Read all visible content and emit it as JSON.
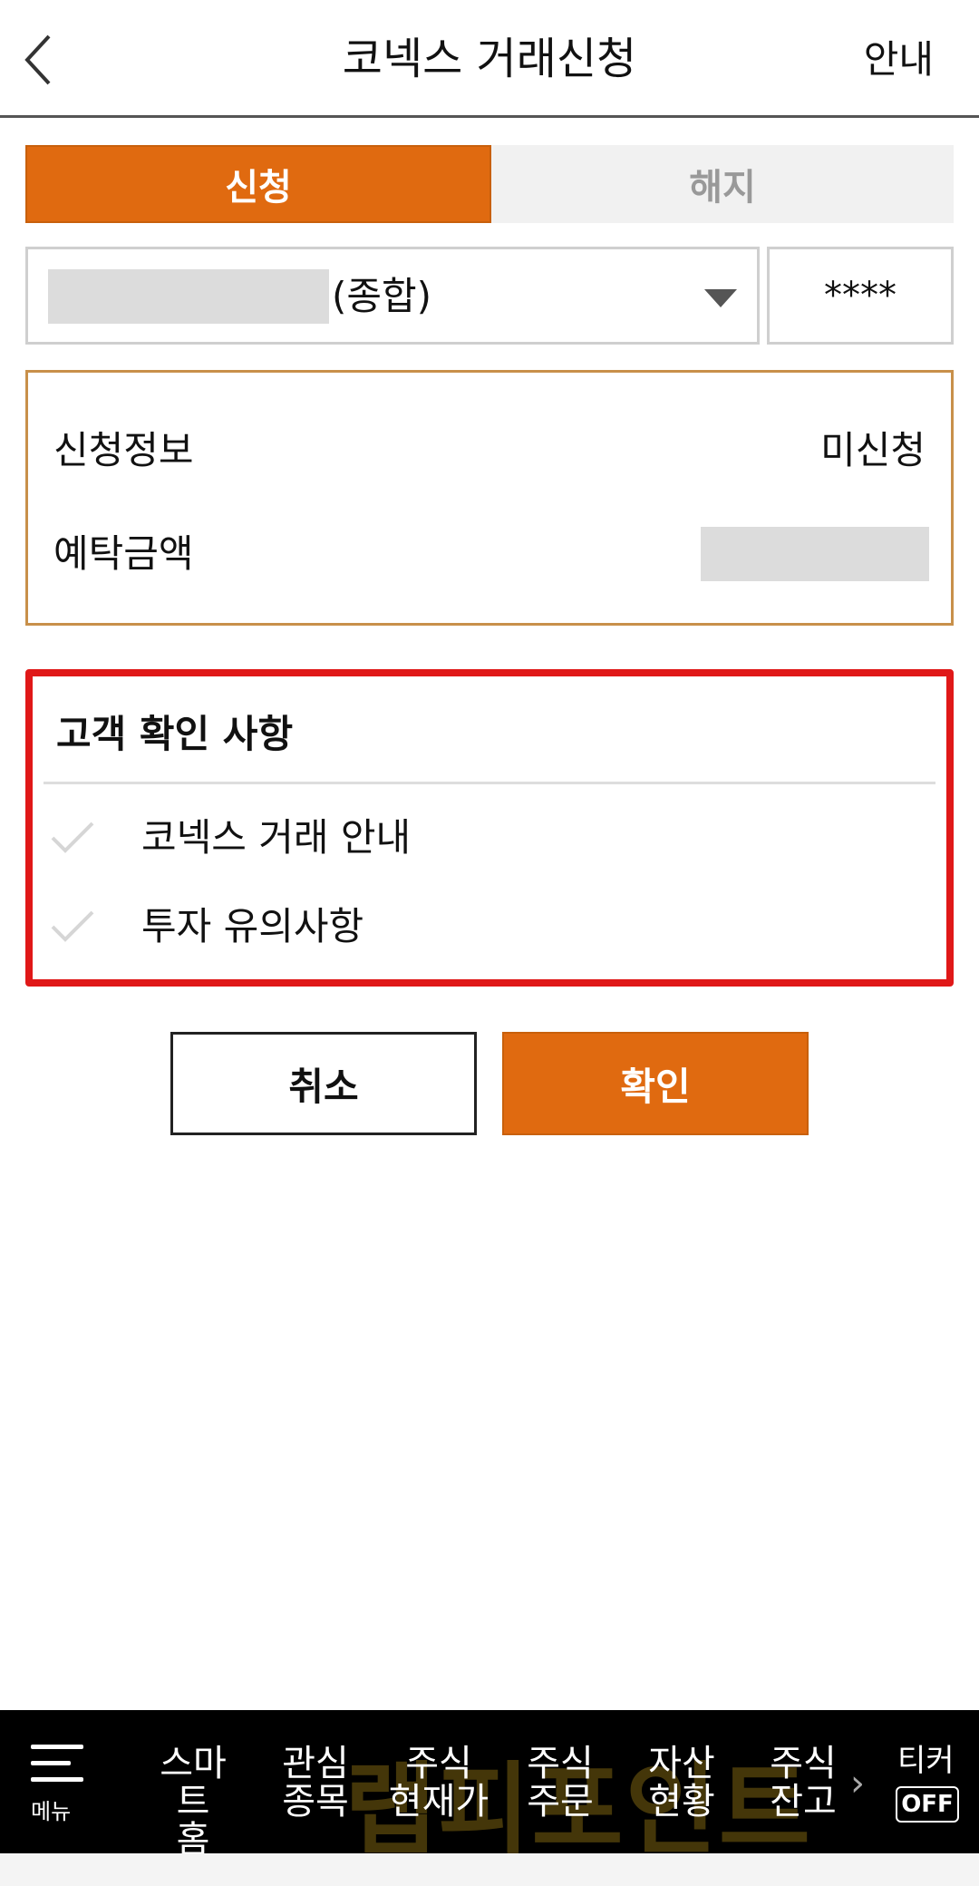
{
  "header": {
    "title": "코넥스 거래신청",
    "guide_label": "안내",
    "back_icon": "chevron-left-icon"
  },
  "tabs": [
    {
      "label": "신청",
      "active": true
    },
    {
      "label": "해지",
      "active": false
    }
  ],
  "account": {
    "suffix": "(종합)",
    "password_mask": "****",
    "dropdown_icon": "caret-down-icon"
  },
  "info": [
    {
      "label": "신청정보",
      "value": "미신청"
    },
    {
      "label": "예탁금액",
      "value": ""
    }
  ],
  "confirm_section": {
    "title": "고객 확인 사항",
    "items": [
      {
        "label": "코넥스 거래 안내",
        "checked": false
      },
      {
        "label": "투자 유의사항",
        "checked": false
      }
    ]
  },
  "buttons": {
    "cancel": "취소",
    "confirm": "확인"
  },
  "bottom_nav": {
    "menu_label": "메뉴",
    "items": [
      "스마트\n홈",
      "관심\n종목",
      "주식\n현재가",
      "주식\n주문",
      "자산\n현황",
      "주식\n잔고"
    ],
    "ticker_label": "티커",
    "ticker_state": "OFF",
    "watermark": "랩피포인트"
  },
  "colors": {
    "accent": "#e06a10",
    "highlight_border": "#e01818",
    "info_border": "#c8904a"
  }
}
